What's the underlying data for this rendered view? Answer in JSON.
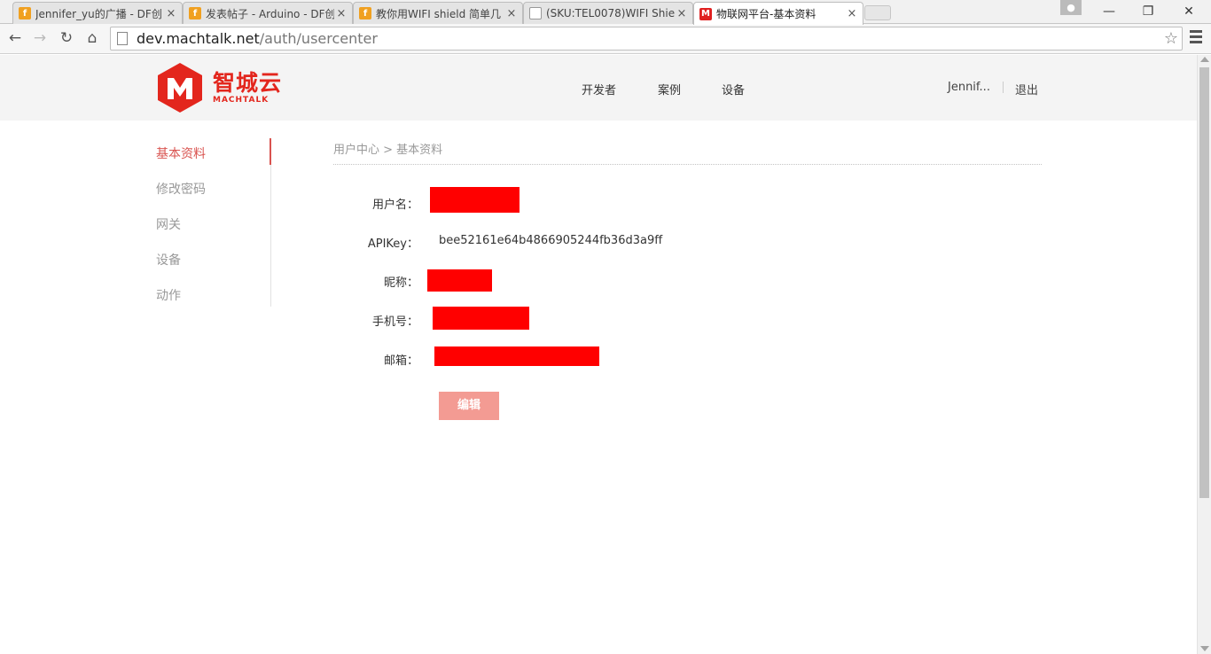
{
  "browser": {
    "tabs": [
      {
        "title": "Jennifer_yu的广播 - DF创",
        "icon": "dfrobot-icon"
      },
      {
        "title": "发表帖子 - Arduino - DF创",
        "icon": "dfrobot-icon"
      },
      {
        "title": "教你用WIFI shield 简单几",
        "icon": "dfrobot-icon"
      },
      {
        "title": "(SKU:TEL0078)WIFI Shie",
        "icon": "document-icon"
      },
      {
        "title": "物联网平台-基本资料",
        "icon": "machtalk-icon",
        "active": true
      }
    ],
    "tab_close": "×",
    "url_host": "dev.machtalk.net",
    "url_path": "/auth/usercenter",
    "nav": {
      "back": "←",
      "forward": "→",
      "reload": "↻",
      "home": "⌂"
    },
    "star": "☆",
    "window": {
      "minimize": "—",
      "restore": "❐",
      "close": "✕",
      "user": "●"
    }
  },
  "header": {
    "logo_cn": "智城云",
    "logo_en": "MACHTALK",
    "nav": [
      "开发者",
      "案例",
      "设备"
    ],
    "username": "Jennif...",
    "logout": "退出",
    "brand_color": "#e3261d"
  },
  "sidebar": {
    "items": [
      "基本资料",
      "修改密码",
      "网关",
      "设备",
      "动作"
    ],
    "active_index": 0,
    "accent_color": "#d9534f"
  },
  "profile": {
    "breadcrumb": "用户中心 > 基本资料",
    "fields": {
      "username_label": "用户名：",
      "apikey_label": "APIKey：",
      "apikey_value": "bee52161e64b4866905244fb36d3a9ff",
      "nickname_label": "昵称：",
      "phone_label": "手机号：",
      "email_label": "邮箱："
    },
    "edit_button": "编辑",
    "redaction_color": "#ff0000"
  }
}
